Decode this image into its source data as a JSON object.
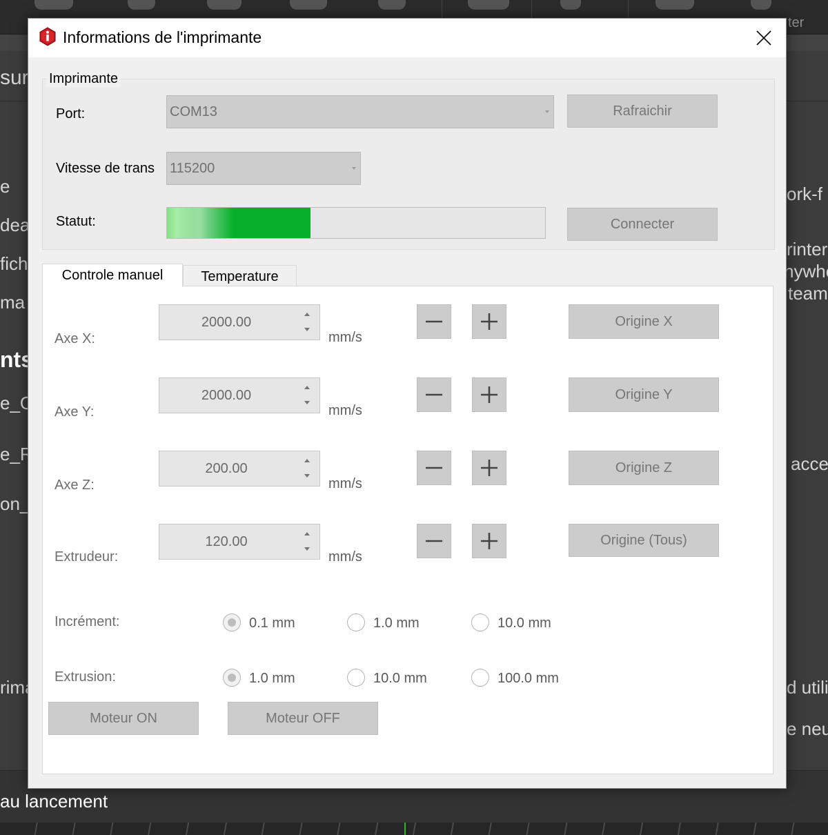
{
  "background": {
    "toolbar_fragment": "ter",
    "left_fragments": [
      "sur",
      "e",
      "dea",
      "fich",
      "ma",
      "nts",
      "e_O",
      "e_R",
      "on_c",
      "rima"
    ],
    "right_fragments": [
      "ork-f",
      "rinter",
      "nywhe",
      "team",
      "acce",
      "d utilis",
      "e neu"
    ],
    "footer_text": "au lancement"
  },
  "dialog": {
    "title": "Informations de l'imprimante",
    "icon": "app-info-icon",
    "close_icon": "close-icon"
  },
  "printer": {
    "group_title": "Imprimante",
    "port_label": "Port:",
    "port_value": "COM13",
    "refresh_label": "Rafraichir",
    "speed_label": "Vitesse de trans",
    "speed_value": "115200",
    "status_label": "Statut:",
    "status_progress": 0.38,
    "connect_label": "Connecter"
  },
  "tabs": [
    {
      "label": "Controle manuel",
      "active": true
    },
    {
      "label": "Temperature",
      "active": false
    }
  ],
  "manual": {
    "axes": [
      {
        "label": "Axe X:",
        "value": "2000.00",
        "unit": "mm/s",
        "home_label": "Origine X"
      },
      {
        "label": "Axe Y:",
        "value": "2000.00",
        "unit": "mm/s",
        "home_label": "Origine Y"
      },
      {
        "label": "Axe Z:",
        "value": "200.00",
        "unit": "mm/s",
        "home_label": "Origine Z"
      },
      {
        "label": "Extrudeur:",
        "value": "120.00",
        "unit": "mm/s",
        "home_label": "Origine (Tous)"
      }
    ],
    "increment": {
      "label": "Incrément:",
      "options": [
        "0.1 mm",
        "1.0 mm",
        "10.0 mm"
      ],
      "selected": 0
    },
    "extrusion": {
      "label": "Extrusion:",
      "options": [
        "1.0 mm",
        "10.0 mm",
        "100.0 mm"
      ],
      "selected": 0
    },
    "motor_on_label": "Moteur ON",
    "motor_off_label": "Moteur OFF"
  },
  "colors": {
    "progress_fill": "#06b02b",
    "app_icon_red": "#c0161c"
  }
}
